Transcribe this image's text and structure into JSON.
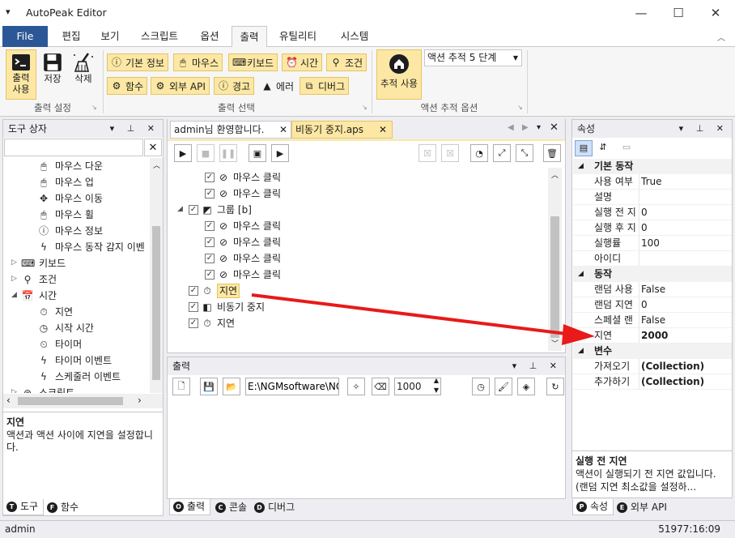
{
  "app": {
    "title": "AutoPeak Editor"
  },
  "ribbon_tabs": [
    "File",
    "편집",
    "보기",
    "스크립트",
    "옵션",
    "출력",
    "유틸리티",
    "시스템"
  ],
  "ribbon": {
    "output_settings": {
      "use": "출력\n사용",
      "save": "저장",
      "delete": "삭제",
      "label": "출력 설정"
    },
    "output_select": {
      "basic": "기본 정보",
      "mouse": "마우스",
      "keyboard": "키보드",
      "time": "시간",
      "condition": "조건",
      "function": "함수",
      "external_api": "외부 API",
      "warning": "경고",
      "error": "에러",
      "debug": "디버그",
      "label": "출력 선택"
    },
    "action_trace": {
      "use": "추적 사용",
      "dropdown": "액션 추적 5 단계",
      "label": "액션 추적 옵션"
    }
  },
  "toolbox": {
    "title": "도구 상자",
    "search_value": "",
    "items": [
      {
        "label": "마우스 다운",
        "icon": "mouse-icon"
      },
      {
        "label": "마우스 업",
        "icon": "mouse-icon"
      },
      {
        "label": "마우스 이동",
        "icon": "move-icon"
      },
      {
        "label": "마우스 휠",
        "icon": "mouse-icon"
      },
      {
        "label": "마우스 정보",
        "icon": "info-icon"
      },
      {
        "label": "마우스 동작 감지 이벤",
        "icon": "lightning-icon"
      },
      {
        "label": "키보드",
        "icon": "keyboard-icon"
      },
      {
        "label": "조건",
        "icon": "condition-icon"
      },
      {
        "label": "시간",
        "icon": "calendar-icon"
      },
      {
        "label": "지연",
        "icon": "timer-icon"
      },
      {
        "label": "시작 시간",
        "icon": "clock-24-icon"
      },
      {
        "label": "타이머",
        "icon": "timer-icon"
      },
      {
        "label": "타이머 이벤트",
        "icon": "lightning-icon"
      },
      {
        "label": "스케줄러 이벤트",
        "icon": "lightning-icon"
      },
      {
        "label": "스크립트",
        "icon": "script-icon"
      }
    ],
    "desc_title": "지연",
    "desc_text": "액션과 액션 사이에 지연을 설정합니다.",
    "tabs": [
      "도구",
      "함수"
    ]
  },
  "editor": {
    "tabs": [
      "admin님 환영합니다.",
      "비동기 중지.aps"
    ],
    "items": [
      {
        "label": "마우스 클릭",
        "icon": "mouse-click-icon"
      },
      {
        "label": "마우스 클릭",
        "icon": "mouse-click-icon"
      },
      {
        "label": "그룹 [b]",
        "icon": "group-icon"
      },
      {
        "label": "마우스 클릭",
        "icon": "mouse-click-icon"
      },
      {
        "label": "마우스 클릭",
        "icon": "mouse-click-icon"
      },
      {
        "label": "마우스 클릭",
        "icon": "mouse-click-icon"
      },
      {
        "label": "마우스 클릭",
        "icon": "mouse-click-icon"
      },
      {
        "label": "지연",
        "icon": "timer-icon"
      },
      {
        "label": "비동기 중지",
        "icon": "async-stop-icon"
      },
      {
        "label": "지연",
        "icon": "timer-icon"
      }
    ]
  },
  "output_panel": {
    "title": "출력",
    "path": "E:\\NGMsoftware\\NG",
    "number": "1000",
    "tabs": [
      "출력",
      "콘솔",
      "디버그"
    ]
  },
  "properties": {
    "title": "속성",
    "categories": [
      {
        "name": "기본 동작",
        "rows": [
          {
            "name": "사용 여부",
            "value": "True"
          },
          {
            "name": "설명",
            "value": ""
          },
          {
            "name": "실행 전 지",
            "value": "0"
          },
          {
            "name": "실행 후 지",
            "value": "0"
          },
          {
            "name": "실행률",
            "value": "100"
          },
          {
            "name": "아이디",
            "value": ""
          }
        ]
      },
      {
        "name": "동작",
        "rows": [
          {
            "name": "랜덤 사용",
            "value": "False"
          },
          {
            "name": "랜덤 지연",
            "value": "0"
          },
          {
            "name": "스페셜 랜",
            "value": "False"
          },
          {
            "name": "지연",
            "value": "2000"
          }
        ]
      },
      {
        "name": "변수",
        "rows": [
          {
            "name": "가져오기",
            "value": "(Collection)"
          },
          {
            "name": "추가하기",
            "value": "(Collection)"
          }
        ]
      }
    ],
    "desc_title": "실행 전 지연",
    "desc_text": "액션이 실행되기 전 지연 값입니다. (랜덤 지연 최소값을 설정하...",
    "tabs": [
      "속성",
      "외부 API"
    ]
  },
  "status": {
    "user": "admin",
    "time": "51977:16:09"
  },
  "colors": {
    "accent": "#2b5797",
    "highlight": "#fce8a4",
    "arrow": "#e81a1a"
  }
}
